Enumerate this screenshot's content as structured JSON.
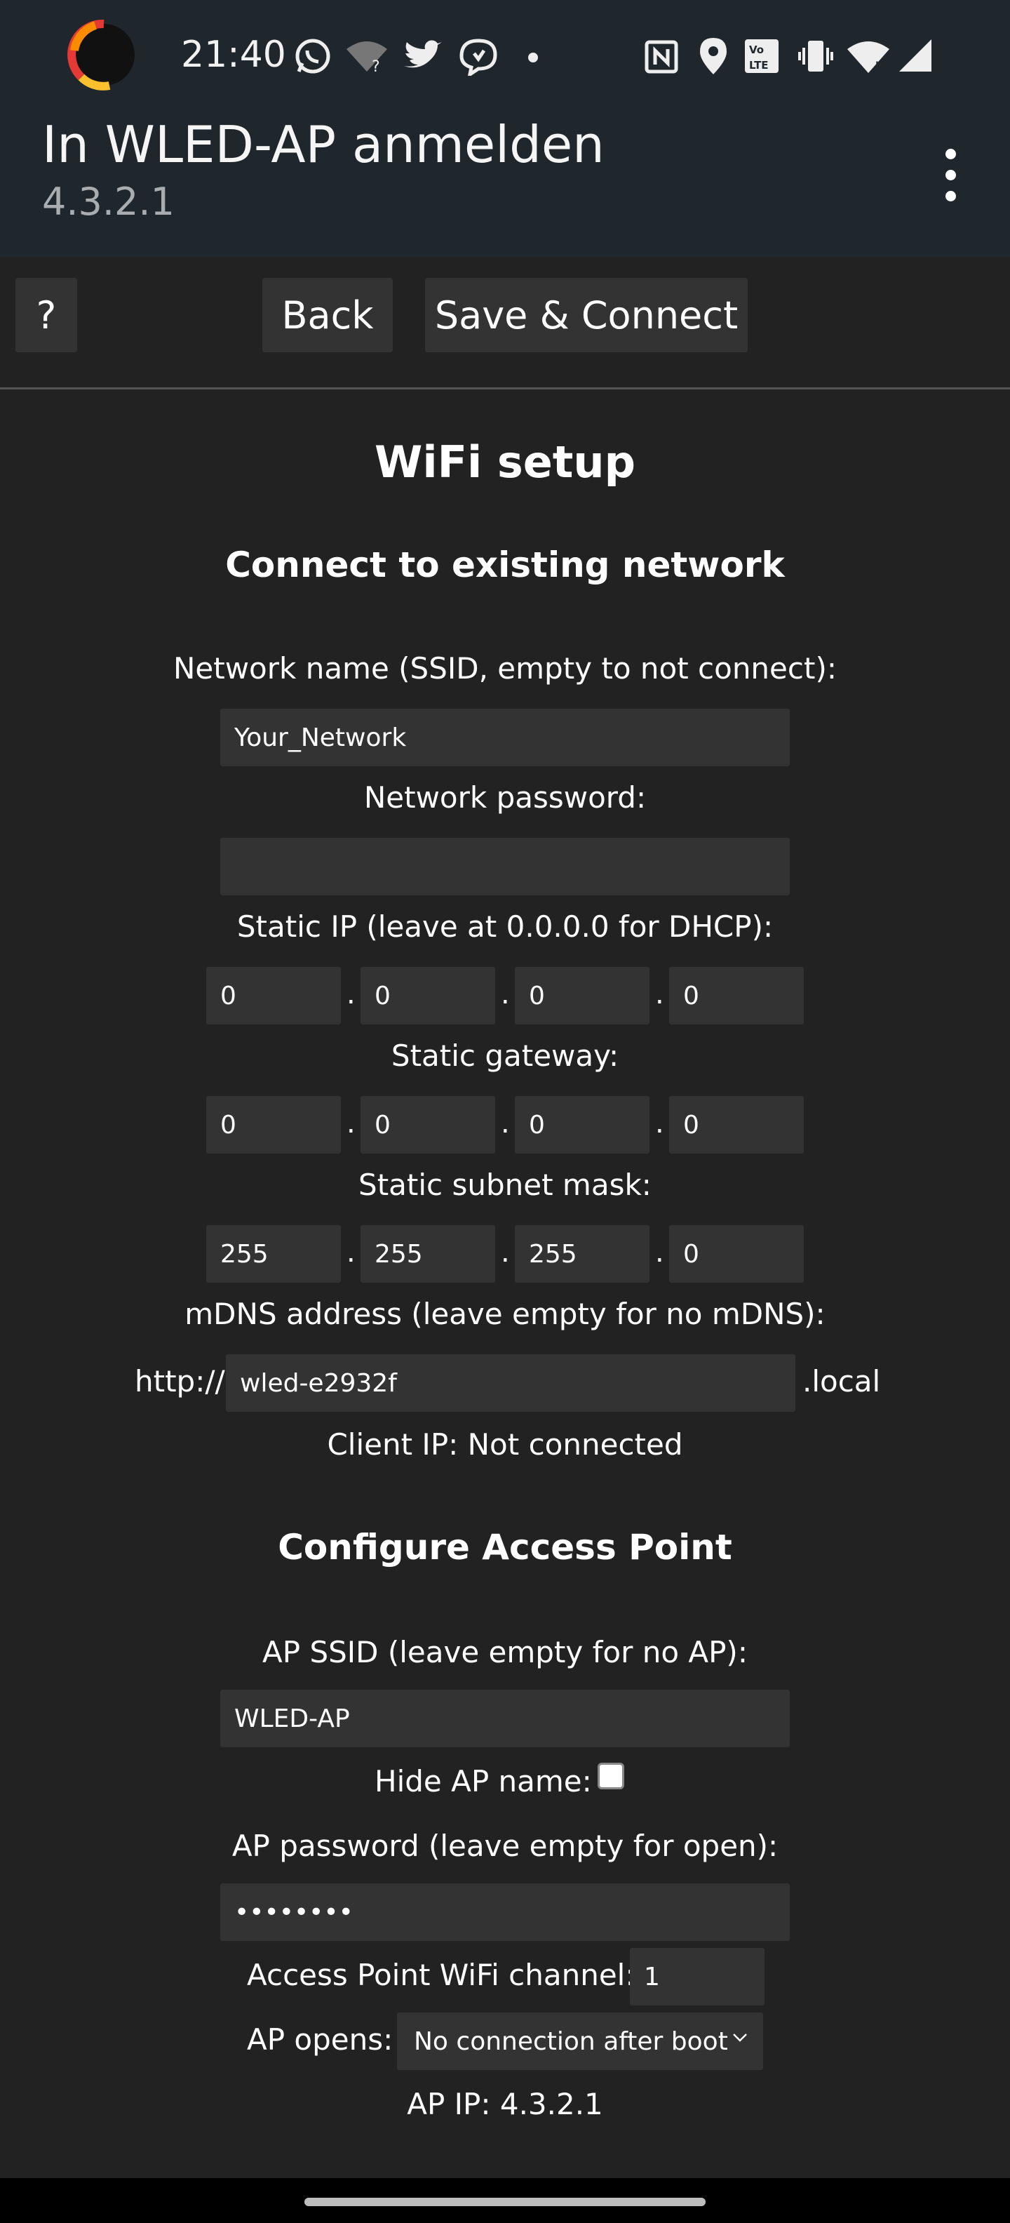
{
  "status": {
    "time": "21:40",
    "icons": [
      "app-ring-icon",
      "whatsapp-icon",
      "wifi-question-icon",
      "twitter-icon",
      "chat-bubble-icon",
      "dot-icon",
      "nfc-icon",
      "location-icon",
      "volte-icon",
      "vibrate-icon",
      "wifi-icon",
      "signal-icon"
    ]
  },
  "app_bar": {
    "title": "In WLED-AP anmelden",
    "subtitle": "4.3.2.1"
  },
  "toolbar": {
    "help_label": "?",
    "back_label": "Back",
    "save_label": "Save & Connect"
  },
  "page": {
    "title": "WiFi setup",
    "network_heading": "Connect to existing network",
    "ssid_label": "Network name (SSID, empty to not connect):",
    "ssid_value": "Your_Network",
    "password_label": "Network password:",
    "password_value": "",
    "static_ip_label": "Static IP (leave at 0.0.0.0 for DHCP):",
    "static_ip": [
      "0",
      "0",
      "0",
      "0"
    ],
    "gateway_label": "Static gateway:",
    "gateway": [
      "0",
      "0",
      "0",
      "0"
    ],
    "subnet_label": "Static subnet mask:",
    "subnet": [
      "255",
      "255",
      "255",
      "0"
    ],
    "ip_separator": ".",
    "mdns_label": "mDNS address (leave empty for no mDNS):",
    "mdns_prefix": "http://",
    "mdns_value": "wled-e2932f",
    "mdns_suffix": ".local",
    "client_ip": "Client IP: Not connected",
    "ap_heading": "Configure Access Point",
    "ap_ssid_label": "AP SSID (leave empty for no AP):",
    "ap_ssid_value": "WLED-AP",
    "hide_ap_label": "Hide AP name:",
    "hide_ap_checked": false,
    "ap_password_label": "AP password (leave empty for open):",
    "ap_password_value": "••••••••",
    "ap_channel_label": "Access Point WiFi channel:",
    "ap_channel_value": "1",
    "ap_opens_label": "AP opens:",
    "ap_opens_value": "No connection after boot",
    "ap_ip": "AP IP: 4.3.2.1"
  }
}
